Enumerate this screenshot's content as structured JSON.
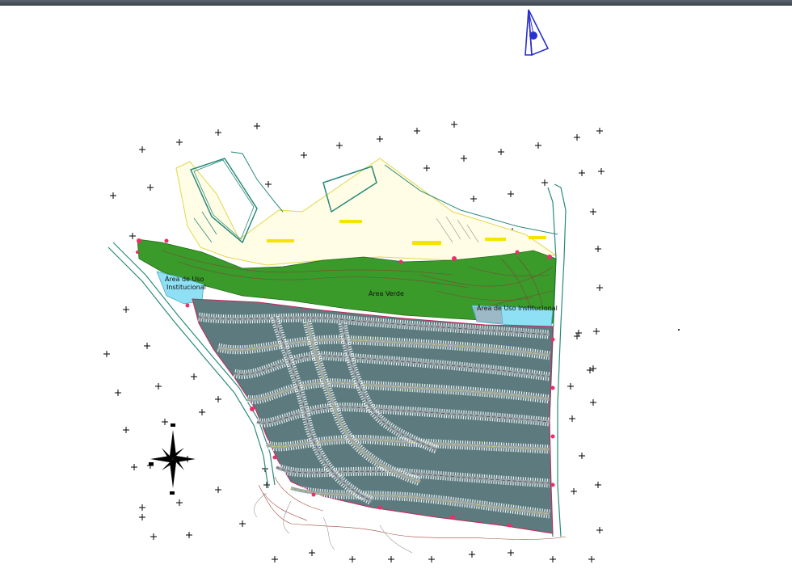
{
  "viewport": {
    "background": "#ffffff"
  },
  "labels": {
    "institutional_left": "Área de Uso Institucional",
    "institutional_left_line1": "Área de Uso",
    "institutional_left_line2": "Institucional",
    "green_area": "Área Verde",
    "institutional_right": "Área de Uso Institucional"
  },
  "colors": {
    "green_area": "#3a9a2a",
    "institutional": "#8fe0f4",
    "lot_band": "#4f6b6f",
    "road": "#9aa3a8",
    "north_arrow": "#2a2fd0",
    "survey_cross": "#000000",
    "site_outline": "#e2d64a"
  },
  "icons": {
    "north_arrow": "north-arrow-icon",
    "compass_rose": "compass-rose-icon"
  }
}
